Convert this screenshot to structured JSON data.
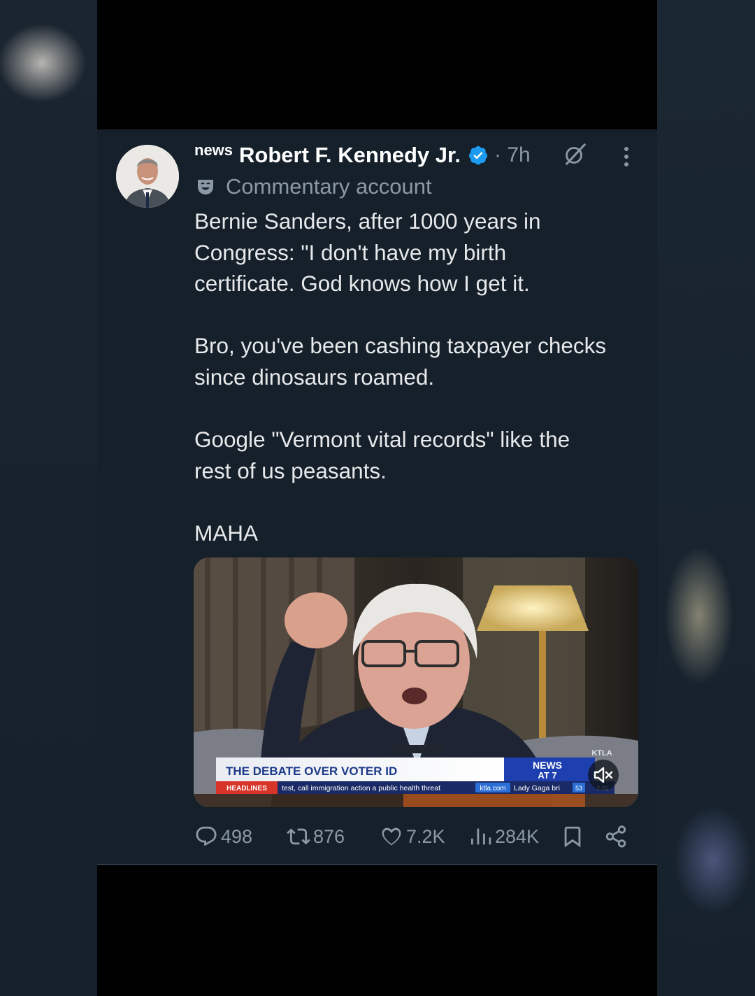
{
  "tweet": {
    "prefix": "news",
    "author": "Robert F. Kennedy Jr.",
    "time": "· 7h",
    "label": "Commentary account",
    "body": [
      "Bernie Sanders, after 1000 years in",
      "Congress: \"I don't have my birth",
      "certificate. God knows how I get it.",
      "Bro, you've been cashing taxpayer checks",
      "since dinosaurs roamed.",
      "Google \"Vermont vital records\" like the",
      "rest of us peasants.",
      "MAHA"
    ]
  },
  "video": {
    "lower_third": "THE DEBATE OVER VOTER ID",
    "news_line1": "NEWS",
    "news_line2": "AT 7",
    "ticker_label": "HEADLINES",
    "ticker_text": "test, call immigration action a public health threat",
    "ticker_site": "ktla.com",
    "ticker_more": "Lady Gaga bri",
    "temp": "53",
    "clock": "7:20",
    "station": "KTLA"
  },
  "actions": {
    "replies": "498",
    "reposts": "876",
    "likes": "7.2K",
    "views": "284K"
  },
  "colors": {
    "background": "#15202b",
    "text": "#e7e9ea",
    "muted": "#8b98a5",
    "verified": "#1d9bf0"
  }
}
